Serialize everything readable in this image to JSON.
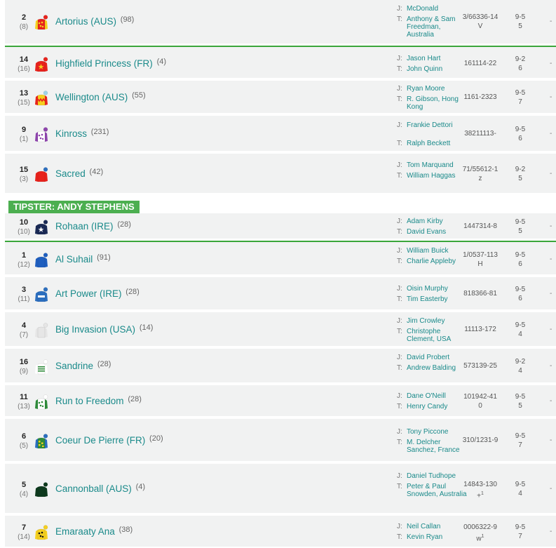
{
  "top_colors": [
    "#ffffff",
    "#f7a72c",
    "#1aa0a8",
    "#9b59b6",
    "#3aa63a",
    "#2c9fd4",
    "#1ab0d0",
    "#c8a07a",
    "#1a2a3a"
  ],
  "tipster": {
    "label": "TIPSTER: ANDY STEPHENS"
  },
  "runners": [
    {
      "num": "2",
      "draw": "(8)",
      "name": "Artorius (AUS)",
      "rating": "(98)",
      "jockey": "McDonald",
      "trainer": "Anthony & Sam Freedman, Australia",
      "form1": "3/66336-14",
      "form2": "V",
      "wt1": "9-5",
      "wt2": "5",
      "silk": "red-yellow-dots"
    },
    {
      "num": "14",
      "draw": "(16)",
      "name": "Highfield Princess (FR)",
      "rating": "(4)",
      "jockey": "Jason Hart",
      "trainer": "John Quinn",
      "form1": "161114-22",
      "form2": "",
      "wt1": "9-2",
      "wt2": "6",
      "silk": "red-star"
    },
    {
      "num": "13",
      "draw": "(15)",
      "name": "Wellington (AUS)",
      "rating": "(55)",
      "jockey": "Ryan Moore",
      "trainer": "R. Gibson, Hong Kong",
      "form1": "1161-2323",
      "form2": "",
      "wt1": "9-5",
      "wt2": "7",
      "silk": "yellow-red"
    },
    {
      "num": "9",
      "draw": "(1)",
      "name": "Kinross",
      "rating": "(231)",
      "jockey": "Frankie Dettori",
      "trainer": "Ralph Beckett",
      "form1": "38211113-",
      "form2": "",
      "wt1": "9-5",
      "wt2": "6",
      "silk": "purple-white"
    },
    {
      "num": "15",
      "draw": "(3)",
      "name": "Sacred",
      "rating": "(42)",
      "jockey": "Tom Marquand",
      "trainer": "William Haggas",
      "form1": "71/55612-1",
      "form2": "z",
      "wt1": "9-2",
      "wt2": "5",
      "silk": "red-blue"
    },
    {
      "num": "10",
      "draw": "(10)",
      "name": "Rohaan (IRE)",
      "rating": "(28)",
      "jockey": "Adam Kirby",
      "trainer": "David Evans",
      "form1": "1447314-8",
      "form2": "",
      "wt1": "9-5",
      "wt2": "5",
      "silk": "navy-star"
    },
    {
      "num": "1",
      "draw": "(12)",
      "name": "Al Suhail",
      "rating": "(91)",
      "jockey": "William Buick",
      "trainer": "Charlie Appleby",
      "form1": "1/0537-113",
      "form2": "H",
      "wt1": "9-5",
      "wt2": "6",
      "silk": "royal-blue"
    },
    {
      "num": "3",
      "draw": "(11)",
      "name": "Art Power (IRE)",
      "rating": "(28)",
      "jockey": "Oisin Murphy",
      "trainer": "Tim Easterby",
      "form1": "818366-81",
      "form2": "",
      "wt1": "9-5",
      "wt2": "6",
      "silk": "blue-white"
    },
    {
      "num": "4",
      "draw": "(7)",
      "name": "Big Invasion (USA)",
      "rating": "(14)",
      "jockey": "Jim Crowley",
      "trainer": "Christophe Clement, USA",
      "form1": "11113-172",
      "form2": "",
      "wt1": "9-5",
      "wt2": "4",
      "silk": "grey"
    },
    {
      "num": "16",
      "draw": "(9)",
      "name": "Sandrine",
      "rating": "(28)",
      "jockey": "David Probert",
      "trainer": "Andrew Balding",
      "form1": "573139-25",
      "form2": "",
      "wt1": "9-2",
      "wt2": "4",
      "silk": "green-stripes"
    },
    {
      "num": "11",
      "draw": "(13)",
      "name": "Run to Freedom",
      "rating": "(28)",
      "jockey": "Dane O'Neill",
      "trainer": "Henry Candy",
      "form1": "101942-41",
      "form2": "0",
      "wt1": "9-5",
      "wt2": "5",
      "silk": "white-green"
    },
    {
      "num": "6",
      "draw": "(5)",
      "name": "Coeur De Pierre (FR)",
      "rating": "(20)",
      "jockey": "Tony Piccone",
      "trainer": "M. Delcher Sanchez, France",
      "form1": "310/1231-9",
      "form2": "",
      "wt1": "9-5",
      "wt2": "7",
      "silk": "green-yellow-check"
    },
    {
      "num": "5",
      "draw": "(4)",
      "name": "Cannonball (AUS)",
      "rating": "(4)",
      "jockey": "Daniel Tudhope",
      "trainer": "Peter & Paul Snowden, Australia",
      "form1": "14843-130",
      "form2": "+1",
      "wt1": "9-5",
      "wt2": "4",
      "silk": "dark-green"
    },
    {
      "num": "7",
      "draw": "(14)",
      "name": "Emaraaty Ana",
      "rating": "(38)",
      "jockey": "Neil Callan",
      "trainer": "Kevin Ryan",
      "form1": "0006322-9",
      "form2": "w1",
      "wt1": "9-5",
      "wt2": "7",
      "silk": "yellow-black"
    }
  ],
  "labels": {
    "jockey": "J:",
    "trainer": "T:",
    "nr": "-"
  }
}
